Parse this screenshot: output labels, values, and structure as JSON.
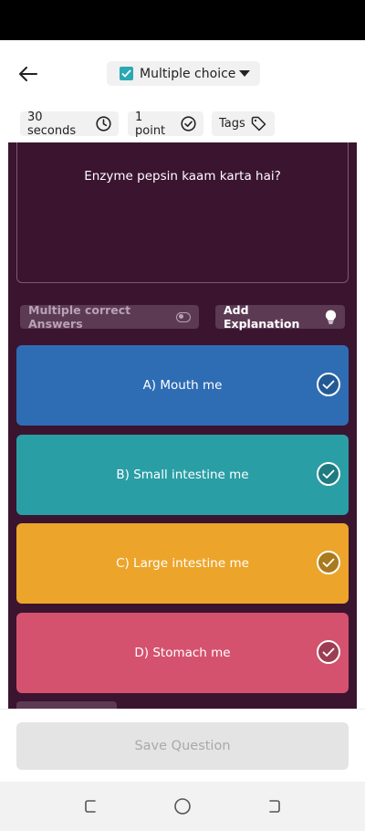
{
  "header": {
    "question_type": "Multiple choice",
    "time": "30 seconds",
    "points": "1 point",
    "tags": "Tags"
  },
  "question": {
    "text": "Enzyme pepsin kaam karta hai?"
  },
  "controls": {
    "multiple_correct_label": "Multiple correct Answers",
    "add_explanation_label": "Add Explanation"
  },
  "options": [
    {
      "label": "A) Mouth me",
      "color": "#2e6db4",
      "tick_fill": "#235a96"
    },
    {
      "label": "B) Small intestine me",
      "color": "#2a9ea5",
      "tick_fill": "#1f7b80"
    },
    {
      "label": "C) Large intestine me",
      "color": "#eca52a",
      "tick_fill": "#a97a1e"
    },
    {
      "label": "D) Stomach me",
      "color": "#d4526e",
      "tick_fill": "#9c3e52"
    }
  ],
  "footer": {
    "save_label": "Save Question"
  },
  "icons": {
    "back": "arrow-left-icon",
    "timer": "clock-icon",
    "points": "check-circle-icon",
    "tags": "tag-icon",
    "explanation": "lightbulb-icon"
  }
}
